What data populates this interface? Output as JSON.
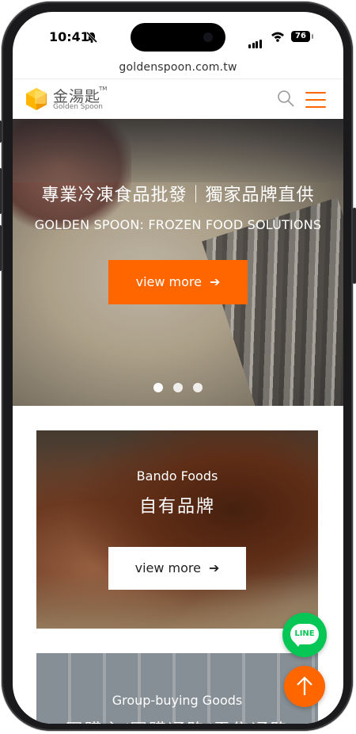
{
  "status_bar": {
    "time": "10:41",
    "battery": "76",
    "icons": [
      "bell-slash-icon",
      "cellular-signal-icon",
      "wifi-icon",
      "battery-icon"
    ]
  },
  "browser": {
    "url": "goldenspoon.com.tw"
  },
  "header": {
    "brand_cn": "金湯匙",
    "brand_tm": "TM",
    "brand_en": "Golden Spoon",
    "icons": [
      "search-icon",
      "hamburger-menu-icon"
    ]
  },
  "hero": {
    "title_cn": "專業冷凍食品批發｜獨家品牌直供",
    "title_en": "GOLDEN SPOON: FROZEN FOOD SOLUTIONS",
    "button_label": "view more",
    "slides": 3,
    "active_slide": 1
  },
  "cards": [
    {
      "subtitle": "Bando Foods",
      "title": "自有品牌",
      "button_label": "view more"
    },
    {
      "subtitle": "Group-buying Goods",
      "title": "團購主/團購通路/零售通路"
    }
  ],
  "floating": {
    "line_label": "LINE",
    "icons": [
      "line-chat-icon",
      "arrow-up-icon"
    ]
  },
  "colors": {
    "accent": "#ff6600",
    "line_green": "#06c755"
  }
}
